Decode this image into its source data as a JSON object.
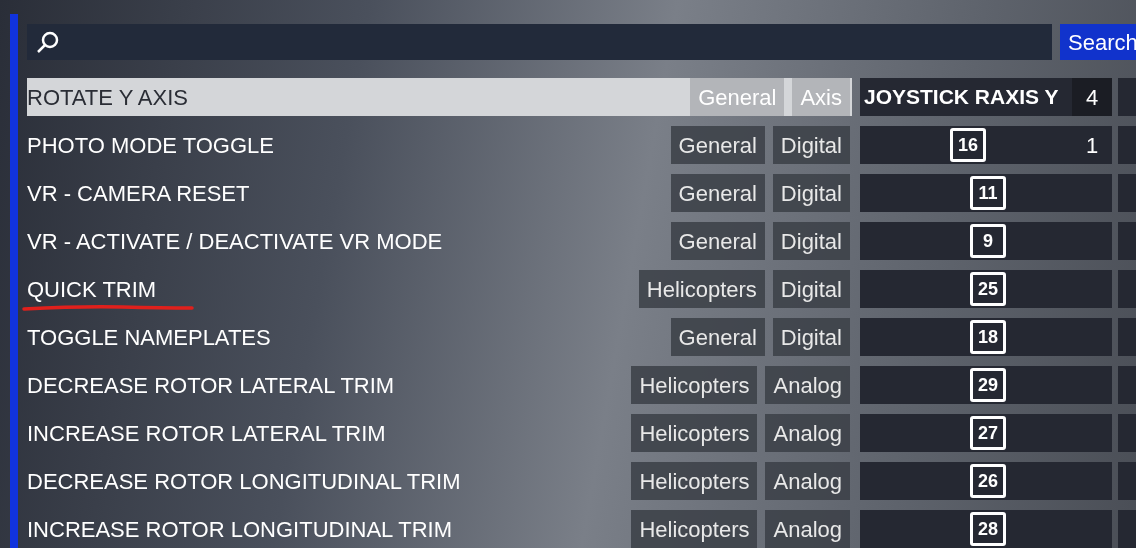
{
  "search": {
    "button": "Search"
  },
  "rows": [
    {
      "action": "ROTATE Y AXIS",
      "category": "General",
      "input_type": "Axis",
      "binding": {
        "kind": "text",
        "label": "JOYSTICK RAXIS Y"
      },
      "count": "4",
      "selected": true,
      "underlined": false
    },
    {
      "action": "PHOTO MODE TOGGLE",
      "category": "General",
      "input_type": "Digital",
      "binding": {
        "kind": "key",
        "label": "16"
      },
      "count": "1",
      "selected": false,
      "underlined": false
    },
    {
      "action": "VR - CAMERA RESET",
      "category": "General",
      "input_type": "Digital",
      "binding": {
        "kind": "key",
        "label": "11"
      },
      "selected": false,
      "underlined": false
    },
    {
      "action": "VR - ACTIVATE / DEACTIVATE VR MODE",
      "category": "General",
      "input_type": "Digital",
      "binding": {
        "kind": "key",
        "label": "9"
      },
      "selected": false,
      "underlined": false
    },
    {
      "action": "QUICK TRIM",
      "category": "Helicopters",
      "input_type": "Digital",
      "binding": {
        "kind": "key",
        "label": "25"
      },
      "selected": false,
      "underlined": true
    },
    {
      "action": "TOGGLE NAMEPLATES",
      "category": "General",
      "input_type": "Digital",
      "binding": {
        "kind": "key",
        "label": "18"
      },
      "selected": false,
      "underlined": false
    },
    {
      "action": "DECREASE ROTOR LATERAL TRIM",
      "category": "Helicopters",
      "input_type": "Analog",
      "binding": {
        "kind": "key",
        "label": "29"
      },
      "selected": false,
      "underlined": false
    },
    {
      "action": "INCREASE ROTOR LATERAL TRIM",
      "category": "Helicopters",
      "input_type": "Analog",
      "binding": {
        "kind": "key",
        "label": "27"
      },
      "selected": false,
      "underlined": false
    },
    {
      "action": "DECREASE ROTOR LONGITUDINAL TRIM",
      "category": "Helicopters",
      "input_type": "Analog",
      "binding": {
        "kind": "key",
        "label": "26"
      },
      "selected": false,
      "underlined": false
    },
    {
      "action": "INCREASE ROTOR LONGITUDINAL TRIM",
      "category": "Helicopters",
      "input_type": "Analog",
      "binding": {
        "kind": "key",
        "label": "28"
      },
      "selected": false,
      "underlined": false
    }
  ]
}
